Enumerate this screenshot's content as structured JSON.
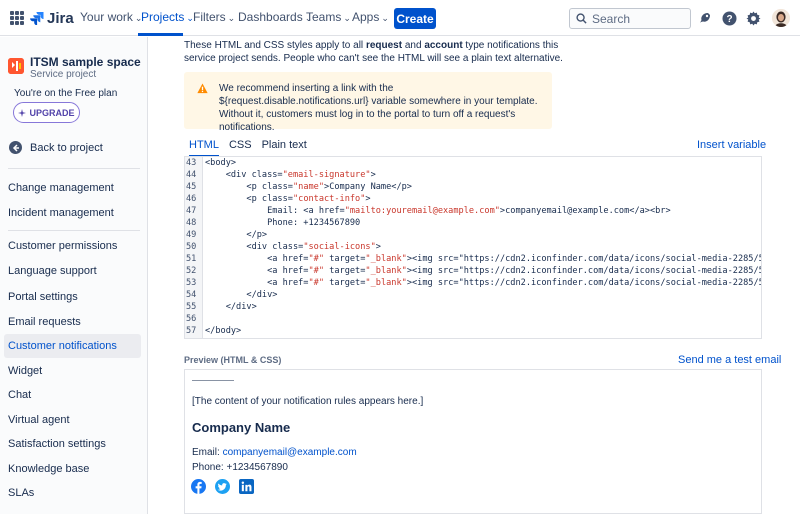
{
  "topnav": {
    "logo_text": "Jira",
    "items": [
      "Your work",
      "Projects",
      "Filters",
      "Dashboards",
      "Teams",
      "Apps"
    ],
    "create_label": "Create",
    "search_placeholder": "Search"
  },
  "sidebar": {
    "project_name": "ITSM sample space",
    "project_type": "Service project",
    "plan_text": "You're on the Free plan",
    "upgrade_label": "UPGRADE",
    "back_label": "Back to project",
    "group1": [
      "Change management",
      "Incident management"
    ],
    "group2": [
      "Customer permissions",
      "Language support",
      "Portal settings",
      "Email requests",
      "Customer notifications",
      "Widget",
      "Chat",
      "Virtual agent",
      "Satisfaction settings",
      "Knowledge base",
      "SLAs"
    ],
    "active_item": "Customer notifications"
  },
  "main": {
    "intro_parts": [
      "These HTML and CSS styles apply to all ",
      "request",
      " and ",
      "account",
      " type notifications this service project sends. People who can't see the HTML will see a plain text alternative."
    ],
    "warning": "We recommend inserting a link with the ${request.disable.notifications.url} variable somewhere in your template. Without it, customers must log in to the portal to turn off a request's notifications.",
    "tabs": [
      "HTML",
      "CSS",
      "Plain text"
    ],
    "active_tab": "HTML",
    "insert_variable": "Insert variable",
    "code": [
      {
        "n": "43",
        "text": "<body>"
      },
      {
        "n": "44",
        "text": "    <div class=\"email-signature\">"
      },
      {
        "n": "45",
        "text": "        <p class=\"name\">Company Name</p>"
      },
      {
        "n": "46",
        "text": "        <p class=\"contact-info\">"
      },
      {
        "n": "47",
        "text": "            Email: <a href=\"mailto:youremail@example.com\">companyemail@example.com</a><br>"
      },
      {
        "n": "48",
        "text": "            Phone: +1234567890"
      },
      {
        "n": "49",
        "text": "        </p>"
      },
      {
        "n": "50",
        "text": "        <div class=\"social-icons\">"
      },
      {
        "n": "51",
        "text": "            <a href=\"#\" target=\"_blank\"><img src=\"https://cdn2.iconfinder.com/data/icons/social-media-2285/5"
      },
      {
        "n": "52",
        "text": "            <a href=\"#\" target=\"_blank\"><img src=\"https://cdn2.iconfinder.com/data/icons/social-media-2285/5"
      },
      {
        "n": "53",
        "text": "            <a href=\"#\" target=\"_blank\"><img src=\"https://cdn2.iconfinder.com/data/icons/social-media-2285/5"
      },
      {
        "n": "54",
        "text": "        </div>"
      },
      {
        "n": "55",
        "text": "    </div>"
      },
      {
        "n": "56",
        "text": ""
      },
      {
        "n": "57",
        "text": "</body>"
      }
    ],
    "preview_label": "Preview (HTML & CSS)",
    "test_email": "Send me a test email",
    "preview": {
      "content_note": "[The content of your notification rules appears here.]",
      "company_name": "Company Name",
      "email_label": "Email: ",
      "email_link": "companyemail@example.com",
      "phone": "Phone: +1234567890",
      "social_icons": [
        "facebook-icon",
        "twitter-icon",
        "linkedin-icon"
      ]
    }
  },
  "colors": {
    "brand": "#0052CC",
    "warning_bg": "#FFF7E6",
    "warning_icon": "#FF8B00",
    "code_string": "#C9372C"
  }
}
